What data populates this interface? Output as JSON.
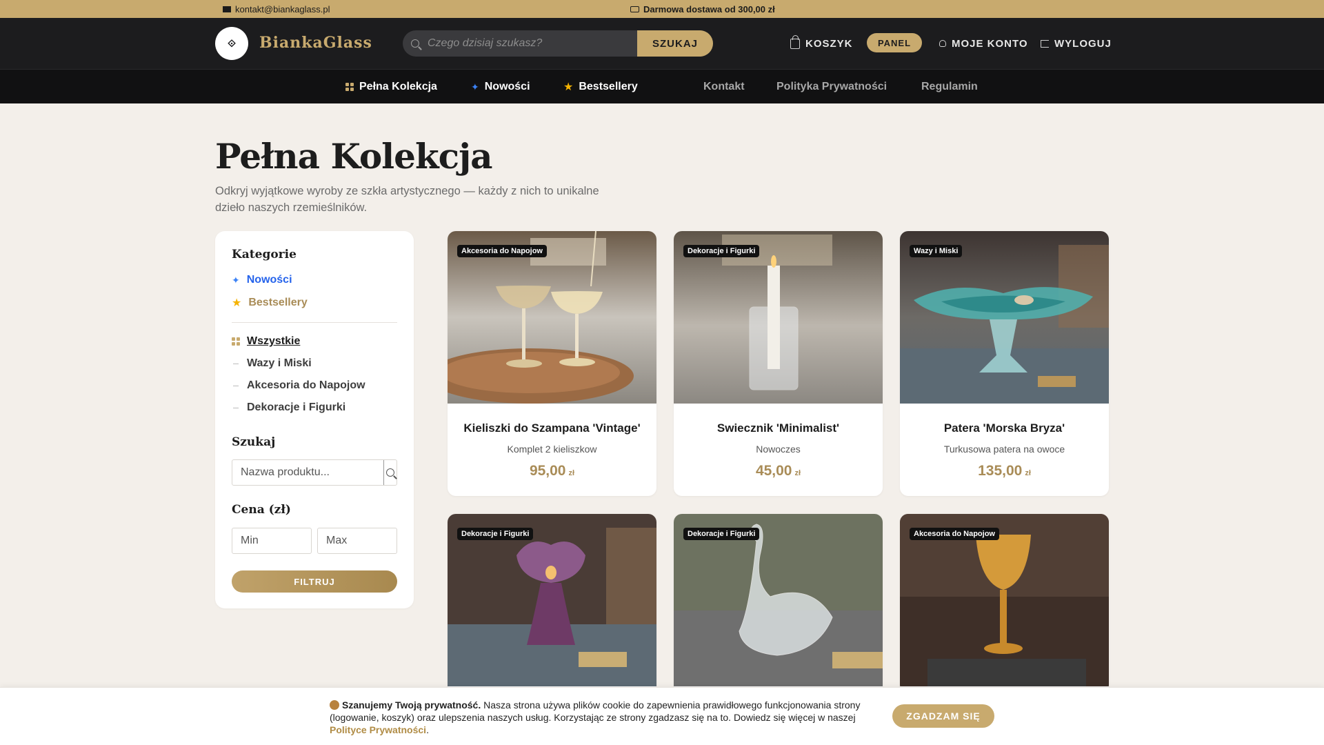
{
  "topbar": {
    "email": "kontakt@biankaglass.pl",
    "shipping": "Darmowa dostawa od 300,00 zł"
  },
  "header": {
    "logo_mark": "⟐",
    "brand": "BiankaGlass",
    "search_placeholder": "Czego dzisiaj szukasz?",
    "search_button": "SZUKAJ",
    "cart": "KOSZYK",
    "panel": "PANEL",
    "account": "MOJE KONTO",
    "logout": "WYLOGUJ"
  },
  "catnav": {
    "items": [
      {
        "label": "Pełna Kolekcja",
        "icon": "grid-icon"
      },
      {
        "label": "Nowości",
        "icon": "sparkle-icon"
      },
      {
        "label": "Bestsellery",
        "icon": "star-icon"
      }
    ],
    "links": [
      "Kontakt",
      "Polityka Prywatności",
      "Regulamin"
    ]
  },
  "page": {
    "title": "Pełna Kolekcja",
    "subtitle": "Odkryj wyjątkowe wyroby ze szkła artystycznego — każdy z nich to unikalne dzieło naszych rzemieślników."
  },
  "sidebar": {
    "categories_heading": "Kategorie",
    "new_label": "Nowości",
    "best_label": "Bestsellery",
    "all_label": "Wszystkie",
    "subcategories": [
      "Wazy i Miski",
      "Akcesoria do Napojow",
      "Dekoracje i Figurki"
    ],
    "search_heading": "Szukaj",
    "search_placeholder": "Nazwa produktu...",
    "price_heading": "Cena (zł)",
    "min_placeholder": "Min",
    "max_placeholder": "Max",
    "filter_button": "FILTRUJ"
  },
  "products": [
    {
      "tag": "Akcesoria do Napojow",
      "name": "Kieliszki do Szampana 'Vintage'",
      "desc": "Komplet 2 kieliszkow",
      "price": "95,00",
      "currency": "zł"
    },
    {
      "tag": "Dekoracje i Figurki",
      "name": "Swiecznik 'Minimalist'",
      "desc": "Nowoczes",
      "price": "45,00",
      "currency": "zł"
    },
    {
      "tag": "Wazy i Miski",
      "name": "Patera 'Morska Bryza'",
      "desc": "Turkusowa patera na owoce",
      "price": "135,00",
      "currency": "zł"
    },
    {
      "tag": "Dekoracje i Figurki"
    },
    {
      "tag": "Dekoracje i Figurki"
    },
    {
      "tag": "Akcesoria do Napojow"
    }
  ],
  "cookie": {
    "lead": "Szanujemy Twoją prywatność.",
    "text": " Nasza strona używa plików cookie do zapewnienia prawidłowego funkcjonowania strony (logowanie, koszyk) oraz ulepszenia naszych usług. Korzystając ze strony zgadzasz się na to. Dowiedz się więcej w naszej ",
    "link": "Polityce Prywatności",
    "end": ".",
    "accept": "ZGADZAM SIĘ"
  },
  "colors": {
    "gold": "#c8aa6e",
    "dark": "#1c1c1e",
    "background": "#f3efea",
    "accent_blue": "#2563eb"
  }
}
